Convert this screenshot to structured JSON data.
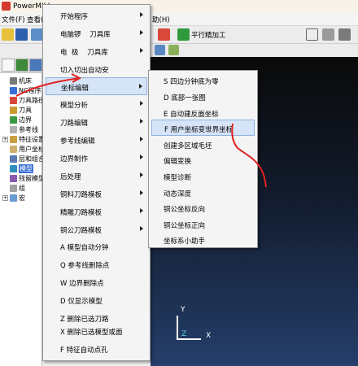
{
  "app": {
    "title": "PowerMILL"
  },
  "menubar": {
    "file": "文件(F)",
    "view": "查看(",
    "help": "助(H)"
  },
  "toolbar": {
    "combo_label": "平行精加工"
  },
  "explorer": {
    "items": [
      {
        "label": "机床"
      },
      {
        "label": "NC程序"
      },
      {
        "label": "刀具路径"
      },
      {
        "label": "刀具"
      },
      {
        "label": "边界"
      },
      {
        "label": "参考线"
      },
      {
        "label": "特征设置"
      },
      {
        "label": "用户坐标"
      },
      {
        "label": "层和组合"
      },
      {
        "label": "模型"
      },
      {
        "label": "残留模型"
      },
      {
        "label": "组"
      },
      {
        "label": "宏"
      }
    ]
  },
  "main_menu": {
    "items": [
      {
        "label": "开始程序"
      },
      {
        "label": "电脑锣    刀具库"
      },
      {
        "label": "电  极    刀具库"
      },
      {
        "label": "切入切出自动安"
      },
      {
        "label": "坐标编辑"
      },
      {
        "label": "模型分析"
      },
      {
        "label": "刀路编辑"
      },
      {
        "label": "参考线编辑"
      },
      {
        "label": "边界制作"
      },
      {
        "label": "后处理"
      },
      {
        "label": "铜料刀路模板"
      },
      {
        "label": "精雕刀路模板"
      },
      {
        "label": "铜公刀路模板"
      },
      {
        "label": "A 模型自动分钟"
      },
      {
        "label": "Q 参考线删除点"
      },
      {
        "label": "W 边界删除点"
      },
      {
        "label": "D 仅显示模型"
      },
      {
        "label": "Z 删除已选刀路"
      },
      {
        "label": "X 删除已选模型或面"
      },
      {
        "label": "F 特征自动点孔"
      }
    ]
  },
  "submenu": {
    "items": [
      {
        "label": "S 四边分钟底为零"
      },
      {
        "label": "D 底部一张图"
      },
      {
        "label": "E 自动建反面坐标"
      },
      {
        "label": "F 用户坐标变世界坐标"
      },
      {
        "label": "创建多区域毛坯"
      },
      {
        "label": "偏辑变换"
      },
      {
        "label": "模型诊断"
      },
      {
        "label": "动态深度"
      },
      {
        "label": "铜公坐标反向"
      },
      {
        "label": "铜公坐标正向"
      },
      {
        "label": "坐标系小助手"
      }
    ]
  },
  "axes": {
    "x": "X",
    "y": "Y",
    "z": "Z"
  }
}
